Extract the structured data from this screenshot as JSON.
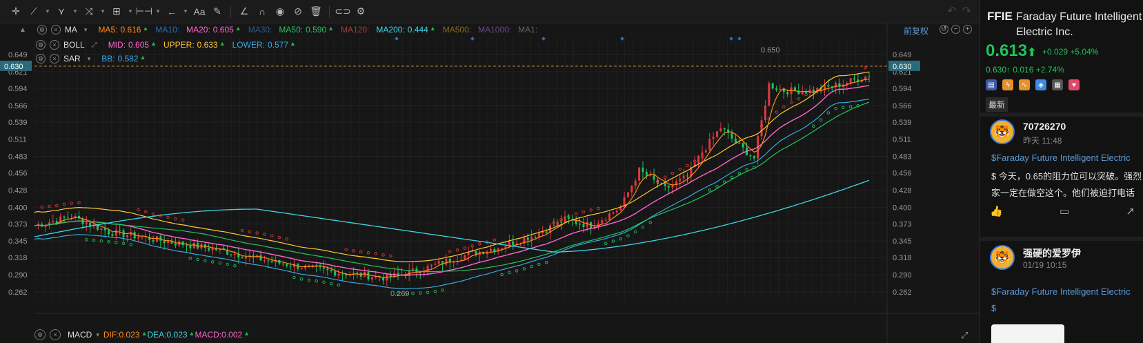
{
  "toolbar": {
    "font_icon_label": "Aa"
  },
  "chart": {
    "reset_label": "前复权",
    "price_labels": [
      "0.649",
      "0.621",
      "0.594",
      "0.566",
      "0.539",
      "0.511",
      "0.483",
      "0.456",
      "0.428",
      "0.400",
      "0.373",
      "0.345",
      "0.318",
      "0.290",
      "0.262"
    ],
    "current_price_tag": "0.630",
    "high_label": "0.650",
    "low_label": "0.269",
    "colors": {
      "ma5": "#ff8c1a",
      "ma20": "#ff66cc",
      "ma50": "#22c55e",
      "ma200": "#3dd6e6",
      "boll_upper": "#ffc933",
      "boll_lower": "#3aa8e0",
      "sar": "#e03a3a",
      "up": "#e0383e",
      "down": "#20c060"
    }
  },
  "indicators": {
    "ma": {
      "name": "MA",
      "items": [
        {
          "label": "MA5:",
          "value": "0.616",
          "color": "#ff8c1a"
        },
        {
          "label": "MA10:",
          "value": "",
          "color": "#2a6fb0"
        },
        {
          "label": "MA20:",
          "value": "0.605",
          "color": "#ff66cc"
        },
        {
          "label": "MA30:",
          "value": "",
          "color": "#2a5a90"
        },
        {
          "label": "MA50:",
          "value": "0.590",
          "color": "#22c55e"
        },
        {
          "label": "MA120:",
          "value": "",
          "color": "#a0403c"
        },
        {
          "label": "MA200:",
          "value": "0.444",
          "color": "#3dd6e6"
        },
        {
          "label": "MA500:",
          "value": "",
          "color": "#8a6a20"
        },
        {
          "label": "MA1000:",
          "value": "",
          "color": "#6a4a90"
        },
        {
          "label": "MA1:",
          "value": "",
          "color": "#666666"
        }
      ]
    },
    "boll": {
      "name": "BOLL",
      "items": [
        {
          "label": "MID:",
          "value": "0.605",
          "color": "#ff66cc"
        },
        {
          "label": "UPPER:",
          "value": "0.633",
          "color": "#ffc933"
        },
        {
          "label": "LOWER:",
          "value": "0.577",
          "color": "#3aa8e0"
        }
      ]
    },
    "sar": {
      "name": "SAR",
      "items": [
        {
          "label": "BB:",
          "value": "0.582",
          "color": "#3aa8e0"
        }
      ]
    },
    "macd": {
      "name": "MACD",
      "items": [
        {
          "label": "DIF:",
          "value": "0.023",
          "color": "#ff8c1a"
        },
        {
          "label": "DEA:",
          "value": "0.023",
          "color": "#3dd6e6"
        },
        {
          "label": "MACD:",
          "value": "0.002",
          "color": "#ff66cc"
        }
      ]
    }
  },
  "quote": {
    "ticker": "FFIE",
    "name_line1": "Faraday Future Intelligent",
    "name_line2": "Electric Inc.",
    "price": "0.613",
    "change": "+0.029",
    "change_pct": "+5.04%",
    "pre_price": "0.630",
    "pre_change": "0.016",
    "pre_change_pct": "+2.74%",
    "tab_latest": "最新"
  },
  "posts": [
    {
      "user": "70726270",
      "time": "昨天 11:48",
      "line1": "$Faraday Future Intelligent Electric",
      "line2": "$ 今天，0.65的阻力位可以突破。强烈",
      "line3": "家一定在做空这个。他们被迫打电话"
    },
    {
      "user": "强硬的爱罗伊",
      "time": "01/19 10:15",
      "line1": "$Faraday Future Intelligent Electric",
      "line2": "$"
    }
  ]
}
